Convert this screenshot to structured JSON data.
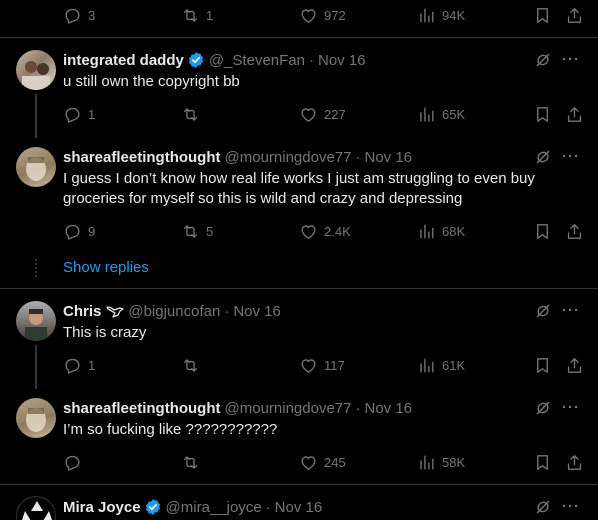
{
  "top_actions": {
    "replies": "3",
    "retweets": "1",
    "likes": "972",
    "views": "94K"
  },
  "tweets": [
    {
      "name": "integrated daddy",
      "handle": "@_StevenFan",
      "date": "Nov 16",
      "verified": true,
      "text": "u still own the copyright bb",
      "replies": "1",
      "retweets": "",
      "likes": "227",
      "views": "65K"
    },
    {
      "name": "shareafleetingthought",
      "handle": "@mourningdove77",
      "date": "Nov 16",
      "text": "I guess I don’t know how real life works I just am struggling to even buy groceries for myself so this is wild and crazy and depressing",
      "replies": "9",
      "retweets": "5",
      "likes": "2.4K",
      "views": "68K"
    },
    {
      "name": "Chris",
      "handle": "@bigjuncofan",
      "date": "Nov 16",
      "text": "This is crazy",
      "replies": "1",
      "retweets": "",
      "likes": "117",
      "views": "61K"
    },
    {
      "name": "shareafleetingthought",
      "handle": "@mourningdove77",
      "date": "Nov 16",
      "text": "I’m so fucking like ???????????",
      "replies": "",
      "retweets": "",
      "likes": "245",
      "views": "58K"
    },
    {
      "name": "Mira Joyce",
      "handle": "@mira__joyce",
      "date": "Nov 16",
      "verified": true,
      "text": ""
    }
  ],
  "show_replies": "Show replies",
  "separator": "·",
  "more": "···",
  "colors": {
    "background": "#000000",
    "text": "#e7e9ea",
    "muted": "#71767b",
    "link": "#1d9bf0",
    "verified": "#1d9bf0",
    "divider": "#2f3336"
  }
}
